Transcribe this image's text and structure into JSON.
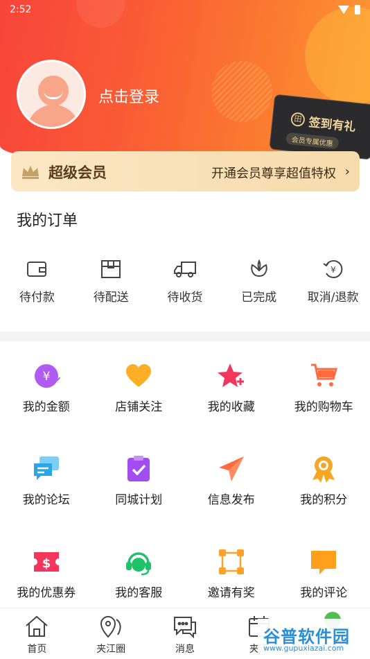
{
  "status_bar": {
    "time": "2:52"
  },
  "header": {
    "login_text": "点击登录",
    "checkin": {
      "title": "签到有礼",
      "subtitle": "会员专属优惠"
    }
  },
  "vip": {
    "title": "超级会员",
    "description": "开通会员尊享超值特权",
    "chevron": "›"
  },
  "orders": {
    "title": "我的订单",
    "items": [
      {
        "label": "待付款",
        "icon": "wallet-icon"
      },
      {
        "label": "待配送",
        "icon": "package-icon"
      },
      {
        "label": "待收货",
        "icon": "truck-icon"
      },
      {
        "label": "已完成",
        "icon": "flower-icon"
      },
      {
        "label": "取消/退款",
        "icon": "refund-icon"
      }
    ]
  },
  "services": [
    {
      "label": "我的金额",
      "icon": "wallet-yen-icon",
      "color": "#b05bf2"
    },
    {
      "label": "店铺关注",
      "icon": "heart-icon",
      "color": "#fcae25"
    },
    {
      "label": "我的收藏",
      "icon": "star-plus-icon",
      "color": "#f5365c"
    },
    {
      "label": "我的购物车",
      "icon": "cart-icon",
      "color": "#ff6b3d"
    },
    {
      "label": "我的论坛",
      "icon": "chat-icon",
      "color": "#2aa6e6"
    },
    {
      "label": "同城计划",
      "icon": "clipboard-check-icon",
      "color": "#a24df0"
    },
    {
      "label": "信息发布",
      "icon": "paper-plane-icon",
      "color": "#ff6b3d"
    },
    {
      "label": "我的积分",
      "icon": "medal-icon",
      "color": "#f5a623"
    },
    {
      "label": "我的优惠券",
      "icon": "coupon-icon",
      "color": "#f5365c"
    },
    {
      "label": "我的客服",
      "icon": "headset-icon",
      "color": "#1fc16b"
    },
    {
      "label": "邀请有奖",
      "icon": "network-icon",
      "color": "#fca12a"
    },
    {
      "label": "我的评论",
      "icon": "comment-icon",
      "color": "#ff9f1c"
    }
  ],
  "bottom_nav": [
    {
      "label": "首页",
      "icon": "home-icon"
    },
    {
      "label": "夹江圈",
      "icon": "location-icon"
    },
    {
      "label": "消息",
      "icon": "message-icon"
    },
    {
      "label": "夹江",
      "icon": "calendar-icon"
    },
    {
      "label": "",
      "icon": "profile-icon"
    }
  ],
  "watermark": {
    "text": "谷普软件园",
    "url": "www.gupuxiazai.com"
  }
}
